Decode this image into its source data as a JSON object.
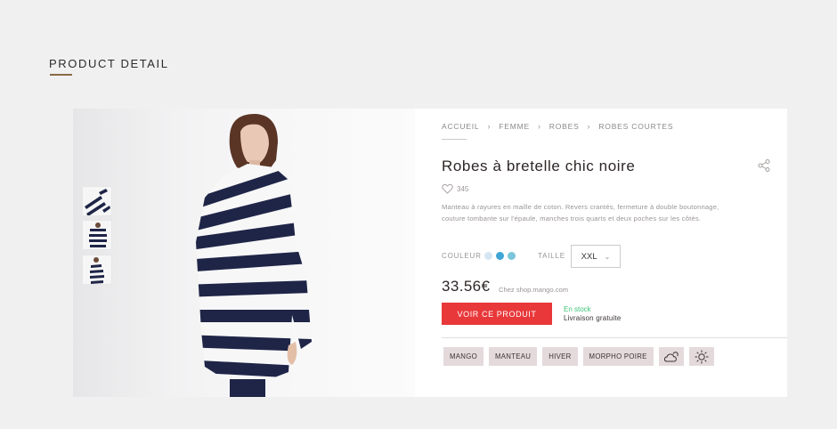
{
  "page": {
    "title": "PRODUCT DETAIL"
  },
  "breadcrumb": {
    "items": [
      "ACCUEIL",
      "FEMME",
      "ROBES",
      "ROBES COURTES"
    ]
  },
  "product": {
    "name": "Robes à bretelle chic noire",
    "likes": "345",
    "description": "Manteau à rayures en maille de coton. Revers crantés, fermeture à double boutonnage, couture tombante sur l'épaule, manches trois quarts et deux poches sur les côtés.",
    "price": "33.56€",
    "store": "Chez shop.mango.com"
  },
  "options": {
    "color_label": "COULEUR",
    "size_label": "TAILLE",
    "size_value": "XXL",
    "swatches": [
      "#d5e6f2",
      "#3fa6d6",
      "#7cc6dc"
    ]
  },
  "actions": {
    "cta_label": "VOIR CE PRODUIT"
  },
  "availability": {
    "stock": "En stock",
    "shipping": "Livraison gratuite"
  },
  "tags": [
    "MANGO",
    "MANTEAU",
    "HIVER",
    "MORPHO POIRE"
  ],
  "tag_icons": [
    "cloud-sun-icon",
    "sun-icon"
  ],
  "colors": {
    "accent": "#e8383a",
    "stock": "#3ec47a",
    "title_underline": "#8a6a48",
    "stripe": "#1f2547"
  }
}
